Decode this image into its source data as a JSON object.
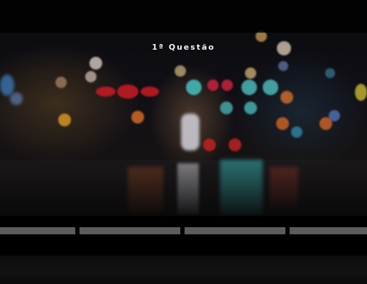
{
  "quiz": {
    "title": "1ª Questão",
    "progress_segments": 4
  },
  "colors": {
    "background": "#050505",
    "title_text": "#f2f2f2",
    "progress_segment": "#5c5c5c",
    "bokeh_red": "#d8202a",
    "bokeh_cyan": "#3fd6d0",
    "bokeh_amber": "#e88a2a"
  }
}
